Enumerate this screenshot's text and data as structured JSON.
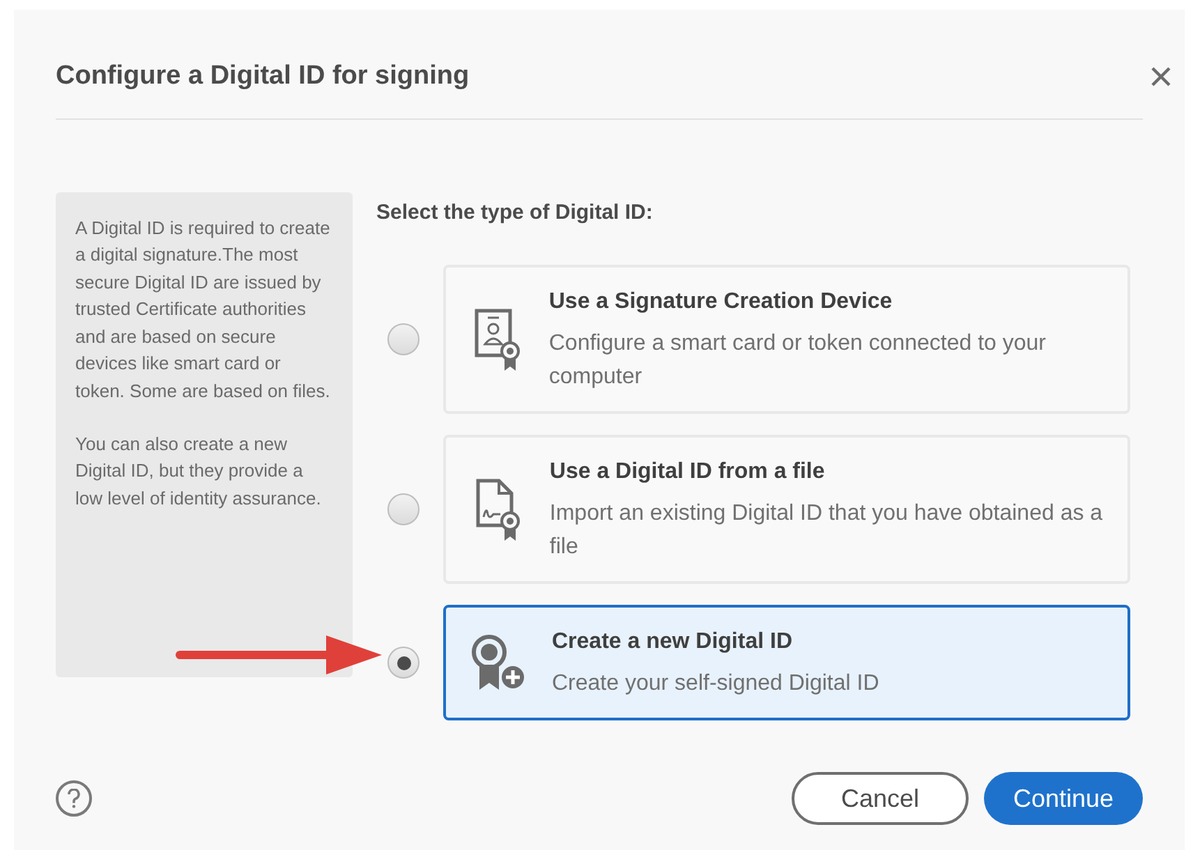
{
  "dialog": {
    "title": "Configure a Digital ID for signing"
  },
  "info_panel": {
    "paragraphs": [
      "A Digital ID is required to create a digital signature.The most secure Digital ID are issued by trusted Certificate authorities and are based on secure devices like smart card or token. Some are based on files.",
      "You can also create a new Digital ID, but they provide a low level of identity assurance."
    ]
  },
  "prompt": "Select the type of Digital ID:",
  "options": [
    {
      "kind": "device",
      "title": "Use a Signature Creation Device",
      "description": "Configure a smart card or token connected to your computer",
      "selected": false
    },
    {
      "kind": "file",
      "title": "Use a Digital ID from a file",
      "description": "Import an existing Digital ID that you have obtained as a file",
      "selected": false
    },
    {
      "kind": "new",
      "title": "Create a new Digital ID",
      "description": "Create your self-signed Digital ID",
      "selected": true
    }
  ],
  "buttons": [
    {
      "label": "Cancel",
      "kind": "secondary"
    },
    {
      "label": "Continue",
      "kind": "primary"
    }
  ]
}
